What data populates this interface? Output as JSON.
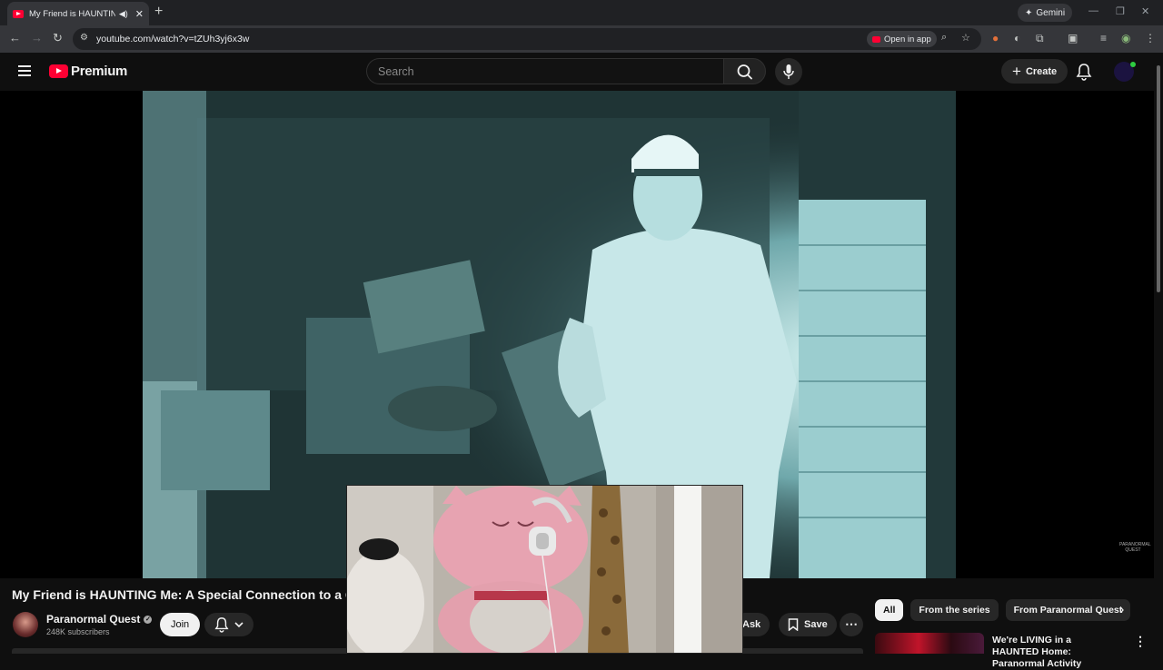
{
  "browser": {
    "tab_title": "My Friend is HAUNTING Me: A Special Connection",
    "new_tab_label": "+",
    "gemini_label": "Gemini",
    "url": "youtube.com/watch?v=tZUh3yj6x3w",
    "open_in_app_label": "Open in app"
  },
  "youtube": {
    "brand": "Premium",
    "search_placeholder": "Search",
    "create_label": "Create"
  },
  "video": {
    "title": "My Friend is HAUNTING Me: A Special Connection to a G",
    "watermark": "PARANORMAL QUEST"
  },
  "channel": {
    "name": "Paranormal Quest",
    "subscribers": "248K subscribers",
    "join_label": "Join"
  },
  "actions": {
    "ask_label": "Ask",
    "save_label": "Save"
  },
  "chips": [
    "All",
    "From the series",
    "From Paranormal Quest"
  ],
  "recommendation": {
    "title": "We're LIVING in a HAUNTED Home: Paranormal Activity"
  },
  "colors": {
    "youtube_red": "#ff0033",
    "background": "#0f0f0f",
    "surface": "#272727"
  }
}
